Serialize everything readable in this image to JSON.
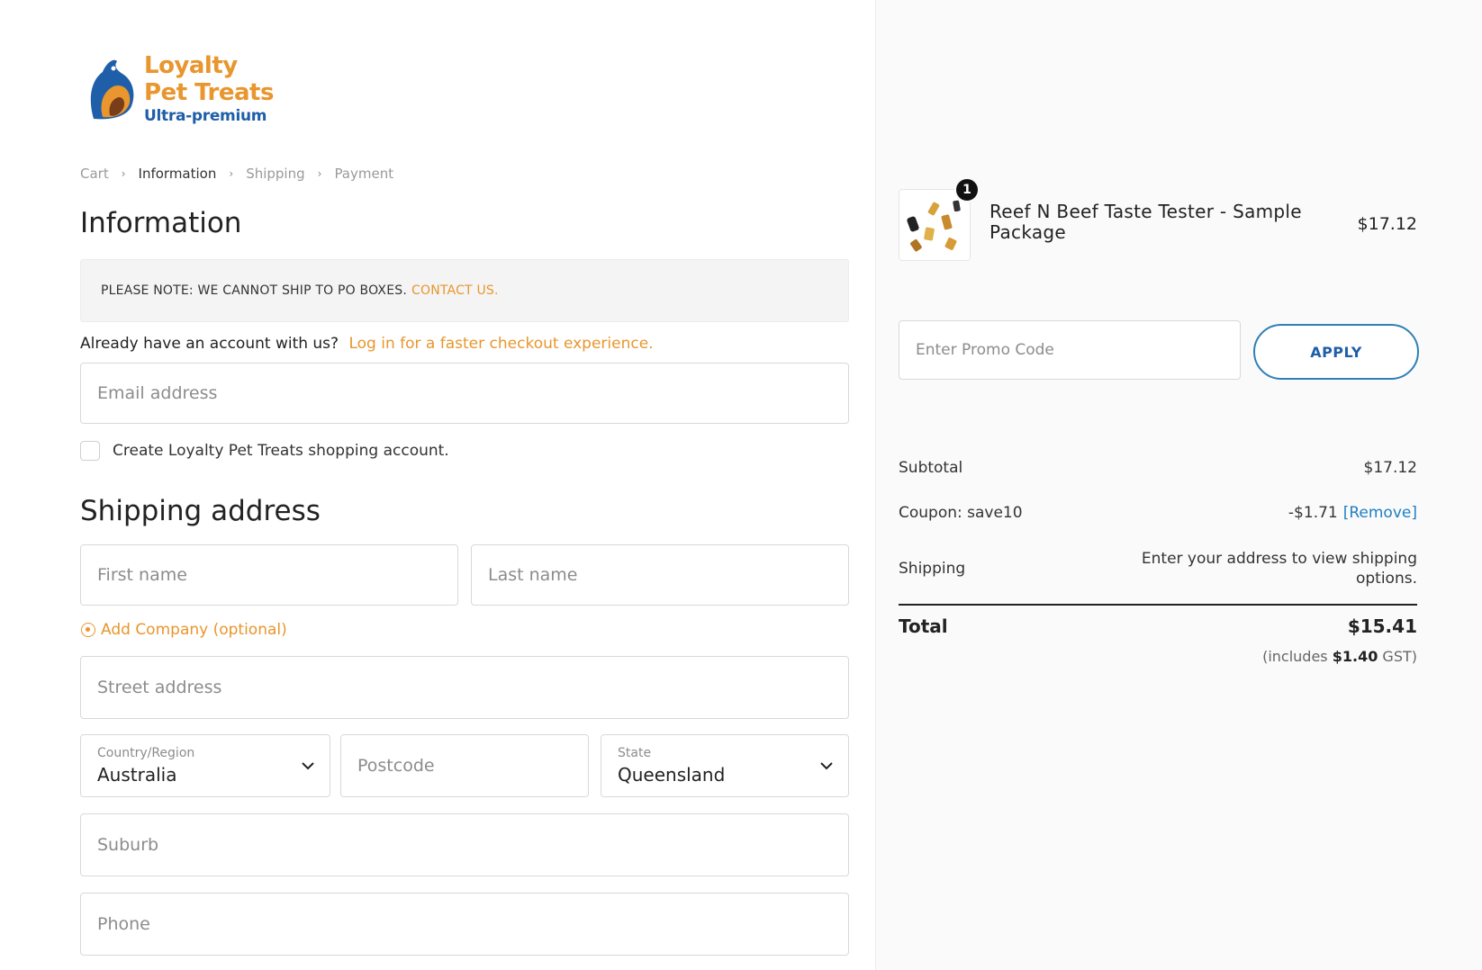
{
  "brand": {
    "line1": "Loyalty",
    "line2": "Pet Treats",
    "line3": "Ultra-premium"
  },
  "breadcrumb": [
    {
      "label": "Cart"
    },
    {
      "label": "Information"
    },
    {
      "label": "Shipping"
    },
    {
      "label": "Payment"
    }
  ],
  "information": {
    "heading": "Information",
    "notice_text": "PLEASE NOTE: WE CANNOT SHIP TO PO BOXES.",
    "notice_link": "CONTACT US.",
    "account_prompt": "Already have an account with us?",
    "login_link": "Log in for a faster checkout experience.",
    "email_placeholder": "Email address",
    "create_account_label": "Create Loyalty Pet Treats shopping account."
  },
  "shipping": {
    "heading": "Shipping address",
    "first_name_placeholder": "First name",
    "last_name_placeholder": "Last name",
    "add_company": "Add Company (optional)",
    "street_placeholder": "Street address",
    "country_label": "Country/Region",
    "country_value": "Australia",
    "postcode_placeholder": "Postcode",
    "state_label": "State",
    "state_value": "Queensland",
    "suburb_placeholder": "Suburb",
    "phone_placeholder": "Phone"
  },
  "order": {
    "product_name": "Reef N Beef Taste Tester - Sample Package",
    "product_qty": "1",
    "product_price": "$17.12",
    "promo_placeholder": "Enter Promo Code",
    "apply_label": "APPLY",
    "subtotal_label": "Subtotal",
    "subtotal_value": "$17.12",
    "coupon_label": "Coupon: save10",
    "coupon_value": "-$1.71",
    "remove_label": "[Remove]",
    "shipping_label": "Shipping",
    "shipping_note_line1": "Enter your address to view shipping",
    "shipping_note_line2": "options.",
    "total_label": "Total",
    "total_value": "$15.41",
    "gst_prefix": "(includes",
    "gst_amount": "$1.40",
    "gst_suffix": "GST)"
  },
  "colors": {
    "accent_orange": "#e8962d",
    "brand_blue": "#1f5ea8",
    "link_blue": "#1f7fc4"
  }
}
